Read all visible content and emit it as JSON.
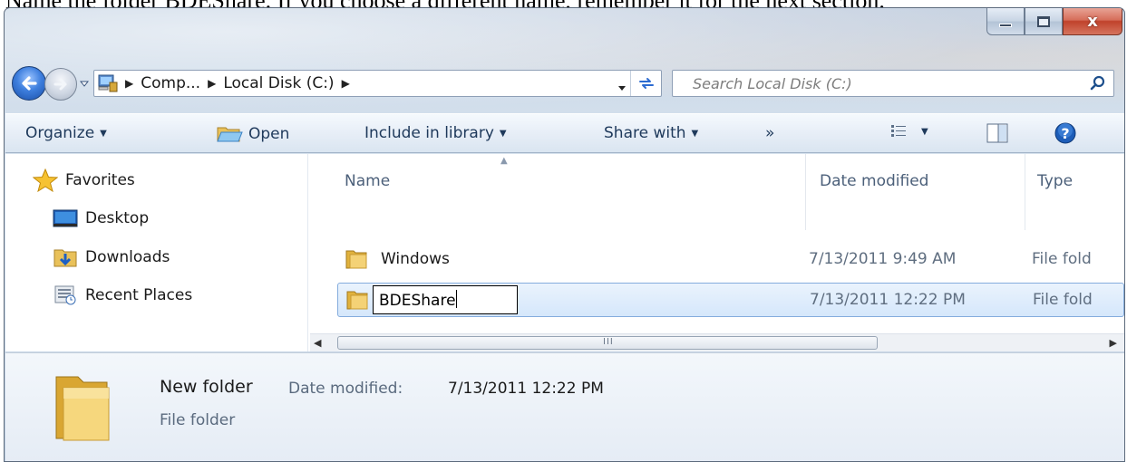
{
  "document": {
    "instruction": "Name the folder BDEShare.  If you choose a different name, remember it for the next section."
  },
  "window": {
    "caption_buttons": {
      "close": "x"
    }
  },
  "address_bar": {
    "crumbs": [
      "Comp...",
      "Local Disk (C:)"
    ],
    "icon": "computer-icon"
  },
  "search": {
    "placeholder": "Search Local Disk (C:)"
  },
  "toolbar": {
    "organize": "Organize",
    "open": "Open",
    "include_in_library": "Include in library",
    "share_with": "Share with",
    "more": "»"
  },
  "nav_pane": {
    "favorites": "Favorites",
    "items": [
      {
        "label": "Desktop",
        "icon": "desktop-icon"
      },
      {
        "label": "Downloads",
        "icon": "downloads-icon"
      },
      {
        "label": "Recent Places",
        "icon": "recent-places-icon"
      }
    ]
  },
  "file_list": {
    "columns": [
      "Name",
      "Date modified",
      "Type"
    ],
    "rows": [
      {
        "name": "Windows",
        "date": "7/13/2011 9:49 AM",
        "type": "File fold"
      },
      {
        "name": "BDEShare",
        "date": "7/13/2011 12:22 PM",
        "type": "File fold",
        "selected": true,
        "renaming": true
      }
    ],
    "scroll_grip": "III"
  },
  "details_pane": {
    "name": "New folder",
    "date_label": "Date modified:",
    "date_value": "7/13/2011 12:22 PM",
    "type": "File folder"
  },
  "colors": {
    "selection_bg": "#d5e7fb",
    "selection_border": "#84acdd",
    "toolbar_text": "#1e395b",
    "close_red": "#c0422b"
  }
}
